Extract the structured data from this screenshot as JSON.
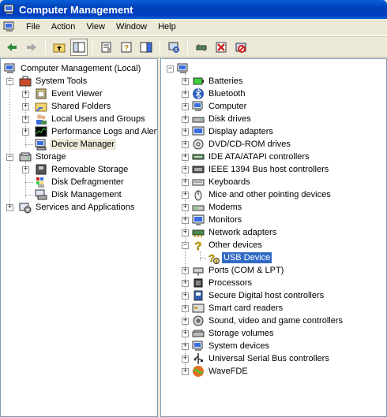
{
  "window": {
    "title": "Computer Management"
  },
  "menu": [
    "File",
    "Action",
    "View",
    "Window",
    "Help"
  ],
  "toolbar": [
    {
      "name": "back-button",
      "icon": "back-arrow"
    },
    {
      "name": "forward-button",
      "icon": "forward-arrow"
    },
    {
      "name": "up-level-button",
      "icon": "folder-up"
    },
    {
      "name": "show-hide-tree-button",
      "icon": "console-tree",
      "pressed": true
    },
    {
      "name": "properties-button",
      "icon": "properties"
    },
    {
      "name": "help-button",
      "icon": "help"
    },
    {
      "name": "export-list-button",
      "icon": "export"
    },
    {
      "name": "scan-hardware-button",
      "icon": "scan-hardware"
    },
    {
      "name": "update-driver-button",
      "icon": "update-driver"
    },
    {
      "name": "uninstall-button",
      "icon": "uninstall"
    },
    {
      "name": "disable-button",
      "icon": "disable"
    }
  ],
  "left_tree": {
    "root": "Computer Management (Local)",
    "system_tools": "System Tools",
    "event_viewer": "Event Viewer",
    "shared_folders": "Shared Folders",
    "local_users": "Local Users and Groups",
    "perf_logs": "Performance Logs and Alerts",
    "device_manager": "Device Manager",
    "storage": "Storage",
    "removable_storage": "Removable Storage",
    "disk_defrag": "Disk Defragmenter",
    "disk_management": "Disk Management",
    "services_apps": "Services and Applications"
  },
  "right_tree": {
    "categories": [
      "Batteries",
      "Bluetooth",
      "Computer",
      "Disk drives",
      "Display adapters",
      "DVD/CD-ROM drives",
      "IDE ATA/ATAPI controllers",
      "IEEE 1394 Bus host controllers",
      "Keyboards",
      "Mice and other pointing devices",
      "Modems",
      "Monitors",
      "Network adapters",
      "Other devices",
      "USB Device",
      "Ports (COM & LPT)",
      "Processors",
      "Secure Digital host controllers",
      "Smart card readers",
      "Sound, video and game controllers",
      "Storage volumes",
      "System devices",
      "Universal Serial Bus controllers",
      "WaveFDE"
    ]
  }
}
